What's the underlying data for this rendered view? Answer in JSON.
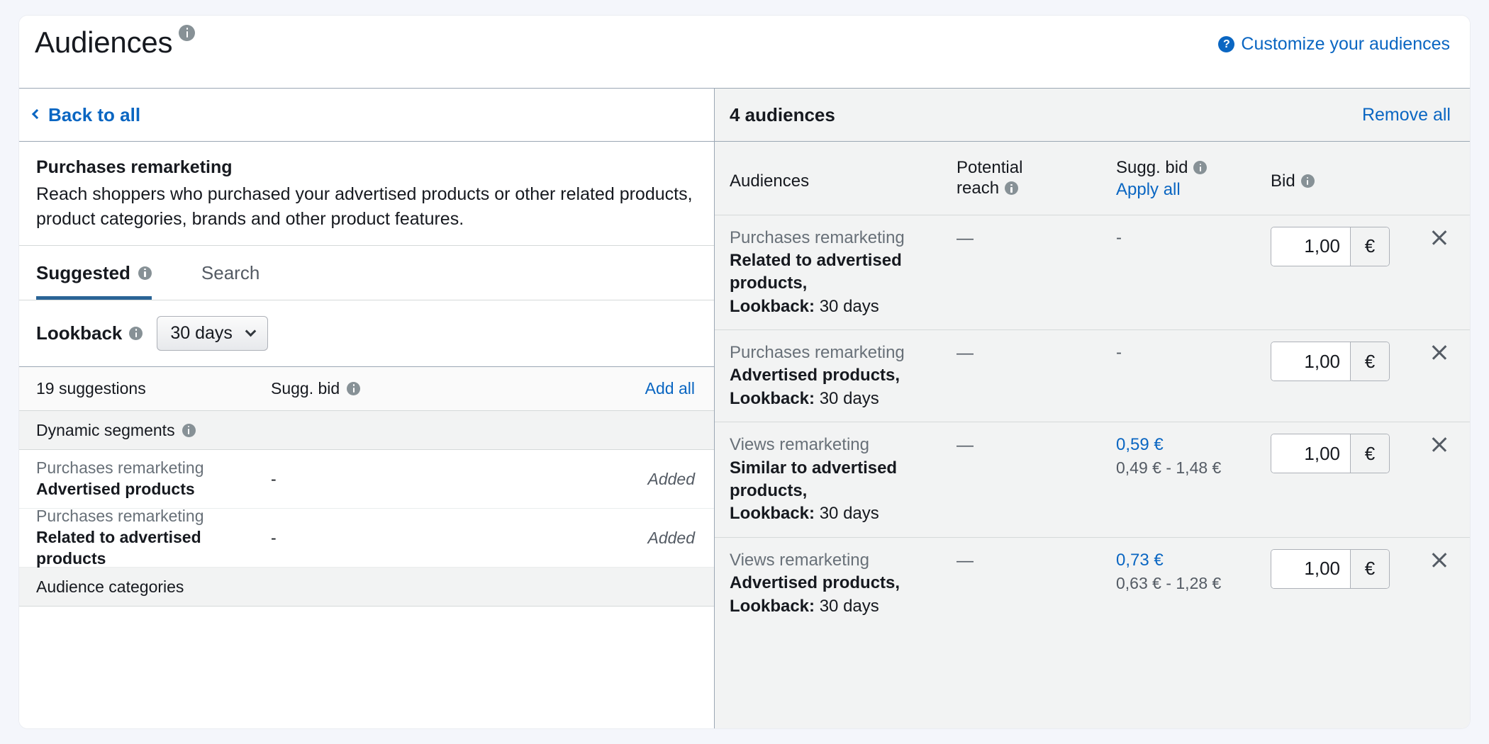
{
  "header": {
    "title": "Audiences",
    "title_info_icon": "info-icon",
    "customize_link": "Customize your audiences",
    "help_icon": "question-circle-icon"
  },
  "left_panel": {
    "back_link": "Back to all",
    "back_icon": "chevron-left-icon",
    "detail_title": "Purchases remarketing",
    "detail_text": "Reach shoppers who purchased your advertised products or other related products, product categories, brands and other product features.",
    "tabs": [
      {
        "label": "Suggested",
        "active": true,
        "info_icon": "info-icon"
      },
      {
        "label": "Search",
        "active": false
      }
    ],
    "lookback": {
      "label": "Lookback",
      "info_icon": "info-icon",
      "value": "30 days",
      "chevron_icon": "chevron-down-icon"
    },
    "suggestions_header": {
      "count_label": "19 suggestions",
      "sugg_bid_label": "Sugg. bid",
      "sugg_bid_info_icon": "info-icon",
      "add_all_label": "Add all"
    },
    "groups": [
      {
        "label": "Dynamic segments",
        "info_icon": "info-icon",
        "rows": [
          {
            "category": "Purchases remarketing",
            "name": "Advertised products",
            "sugg_bid": "-",
            "status": "Added"
          },
          {
            "category": "Purchases remarketing",
            "name": "Related to advertised products",
            "sugg_bid": "-",
            "status": "Added"
          }
        ]
      },
      {
        "label": "Audience categories",
        "info_icon": "",
        "rows": []
      }
    ]
  },
  "right_panel": {
    "count_label": "4 audiences",
    "remove_all_label": "Remove all",
    "columns": {
      "audiences": "Audiences",
      "potential_reach_line1": "Potential",
      "potential_reach_line2": "reach",
      "potential_reach_info_icon": "info-icon",
      "sugg_bid": "Sugg. bid",
      "sugg_bid_info_icon": "info-icon",
      "apply_all": "Apply all",
      "bid": "Bid",
      "bid_info_icon": "info-icon"
    },
    "rows": [
      {
        "category": "Purchases remarketing",
        "name": "Related to advertised products,",
        "lookback_label": "Lookback:",
        "lookback_value": "30 days",
        "potential_reach": "—",
        "sugg_bid": "-",
        "sugg_bid_is_link": false,
        "sugg_bid_range": "",
        "bid_value": "1,00",
        "currency": "€",
        "remove_icon": "close-icon"
      },
      {
        "category": "Purchases remarketing",
        "name": "Advertised products,",
        "lookback_label": "Lookback:",
        "lookback_value": "30 days",
        "potential_reach": "—",
        "sugg_bid": "-",
        "sugg_bid_is_link": false,
        "sugg_bid_range": "",
        "bid_value": "1,00",
        "currency": "€",
        "remove_icon": "close-icon"
      },
      {
        "category": "Views remarketing",
        "name": "Similar to advertised products,",
        "lookback_label": "Lookback:",
        "lookback_value": "30 days",
        "potential_reach": "—",
        "sugg_bid": "0,59 €",
        "sugg_bid_is_link": true,
        "sugg_bid_range": "0,49 € - 1,48 €",
        "bid_value": "1,00",
        "currency": "€",
        "remove_icon": "close-icon"
      },
      {
        "category": "Views remarketing",
        "name": "Advertised products,",
        "lookback_label": "Lookback:",
        "lookback_value": "30 days",
        "potential_reach": "—",
        "sugg_bid": "0,73 €",
        "sugg_bid_is_link": true,
        "sugg_bid_range": "0,63 € - 1,28 €",
        "bid_value": "1,00",
        "currency": "€",
        "remove_icon": "close-icon"
      }
    ]
  },
  "colors": {
    "link_blue": "#0a66c2",
    "tab_underline": "#2a6496",
    "page_bg": "#f4f6fb",
    "panel_bg": "#f2f3f3",
    "text": "#16191f",
    "muted": "#687078"
  }
}
